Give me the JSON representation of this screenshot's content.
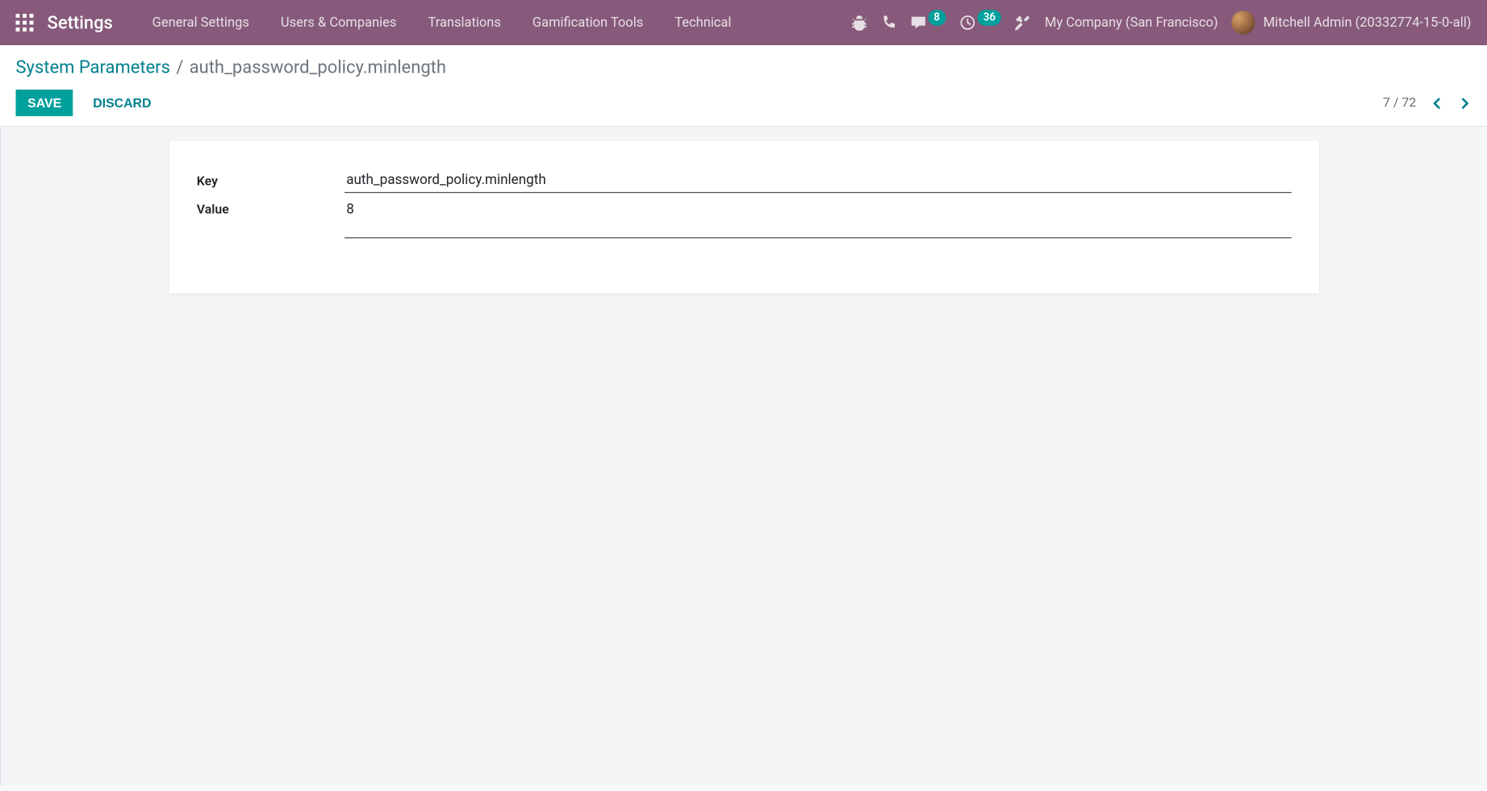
{
  "topnav": {
    "app_title": "Settings",
    "menu": [
      "General Settings",
      "Users & Companies",
      "Translations",
      "Gamification Tools",
      "Technical"
    ],
    "messages_count": "8",
    "activities_count": "36",
    "company": "My Company (San Francisco)",
    "user": "Mitchell Admin (20332774-15-0-all)"
  },
  "breadcrumb": {
    "parent": "System Parameters",
    "current": "auth_password_policy.minlength"
  },
  "buttons": {
    "save": "Save",
    "discard": "Discard"
  },
  "pager": {
    "text": "7 / 72"
  },
  "form": {
    "key_label": "Key",
    "key_value": "auth_password_policy.minlength",
    "value_label": "Value",
    "value_value": "8"
  }
}
